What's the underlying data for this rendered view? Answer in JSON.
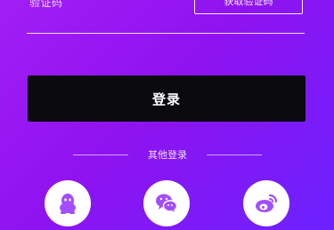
{
  "form": {
    "code_label": "验证码",
    "get_code_button": "获取验证码",
    "login_button": "登录"
  },
  "other_login": {
    "label": "其他登录",
    "providers": [
      {
        "name": "qq",
        "icon": "qq-icon"
      },
      {
        "name": "wechat",
        "icon": "wechat-icon"
      },
      {
        "name": "weibo",
        "icon": "weibo-icon"
      }
    ]
  },
  "colors": {
    "background_start": "#a21ef5",
    "background_end": "#6c22ff",
    "login_button_bg": "#0b0a0f",
    "icon_tint": "#a24dff"
  }
}
